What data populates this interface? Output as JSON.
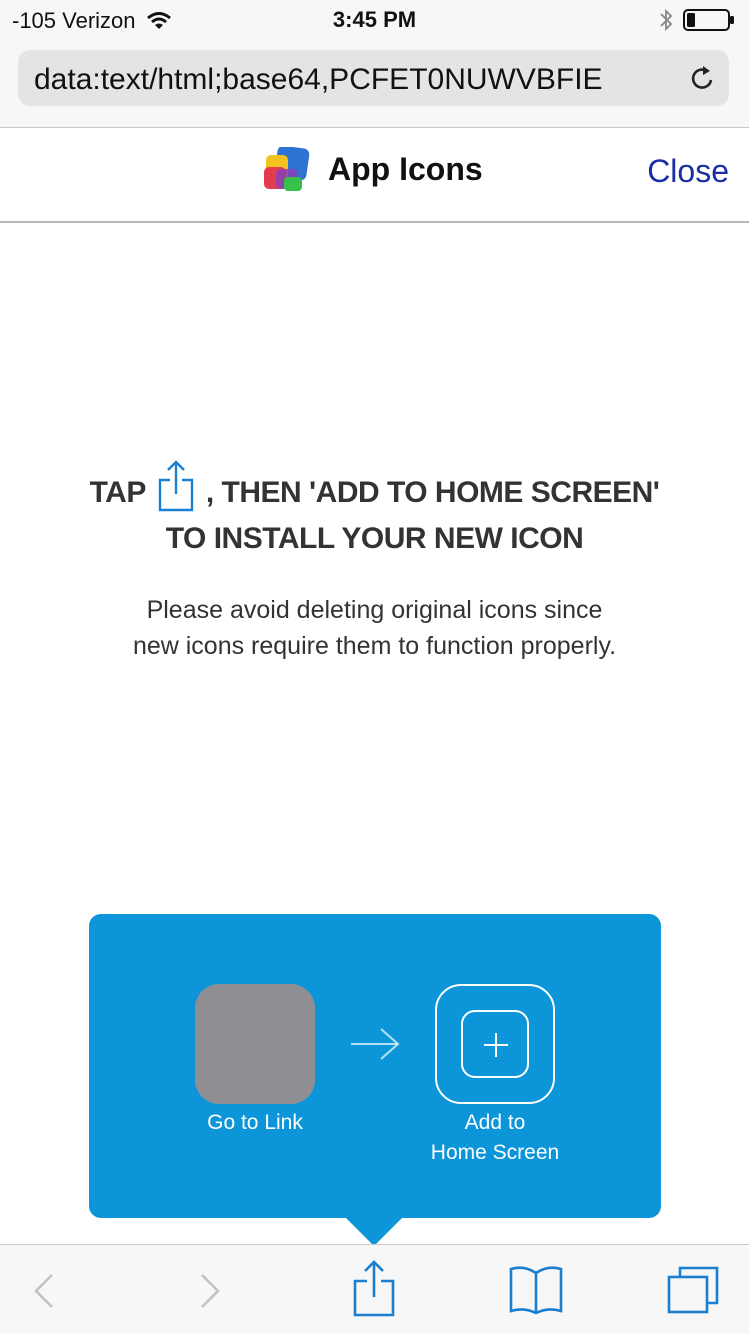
{
  "status_bar": {
    "carrier": "-105 Verizon",
    "time": "3:45 PM"
  },
  "url_bar": {
    "url": "data:text/html;base64,PCFET0NUWVBFIE"
  },
  "header": {
    "title": "App Icons",
    "close_label": "Close"
  },
  "instructions": {
    "tap": "TAP",
    "then": ", THEN 'ADD TO HOME SCREEN'",
    "line2": "TO INSTALL YOUR NEW ICON",
    "note_line1": "Please avoid deleting original icons since",
    "note_line2": "new icons require them to function properly."
  },
  "popup": {
    "go_to_link": "Go to Link",
    "add_to_line1": "Add to",
    "add_to_line2": "Home Screen"
  },
  "colors": {
    "popup_blue": "#0c95d8",
    "ios_blue": "#1a7fd0",
    "close_link": "#1a2fa6"
  },
  "icons": [
    "wifi-icon",
    "bluetooth-icon",
    "battery-icon",
    "reload-icon",
    "app-logo-icon",
    "share-icon",
    "arrow-right-icon",
    "plus-icon",
    "back-icon",
    "forward-icon",
    "bookmarks-icon",
    "tabs-icon"
  ]
}
